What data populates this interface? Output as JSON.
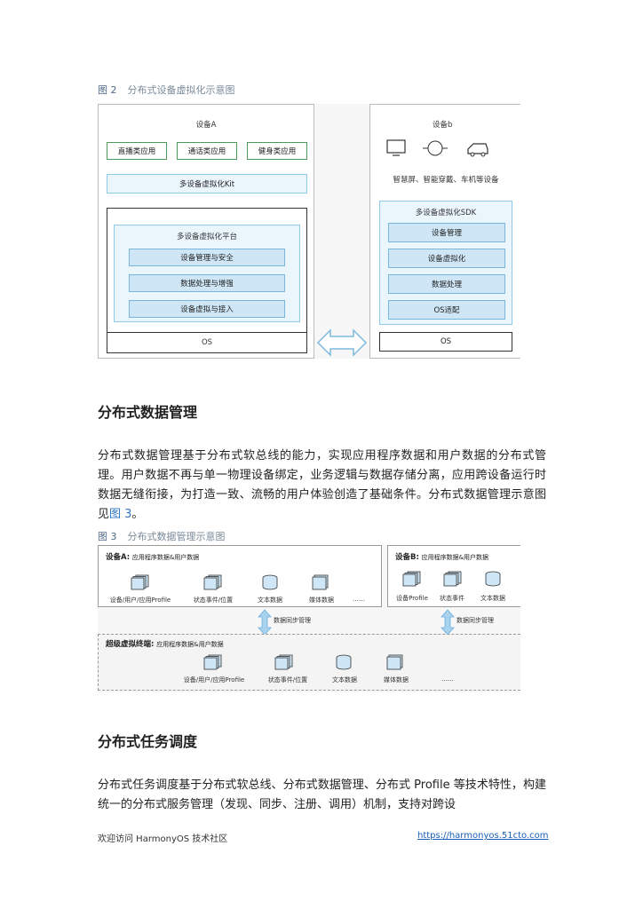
{
  "fig2": {
    "num": "图 2",
    "caption": "分布式设备虚拟化示意图",
    "device_a": {
      "title": "设备A",
      "apps": [
        "直播类应用",
        "通话类应用",
        "健身类应用"
      ],
      "kit": "多设备虚拟化Kit",
      "platform": "多设备虚拟化平台",
      "platform_items": [
        "设备管理与安全",
        "数据处理与增强",
        "设备虚拟与接入"
      ],
      "os": "OS"
    },
    "device_b": {
      "title": "设备b",
      "devices_label": "智慧屏、智能穿戴、车机等设备",
      "sdk": "多设备虚拟化SDK",
      "sdk_items": [
        "设备管理",
        "设备虚拟化",
        "数据处理",
        "OS适配"
      ],
      "os": "OS"
    }
  },
  "section1": {
    "heading": "分布式数据管理",
    "para": "分布式数据管理基于分布式软总线的能力，实现应用程序数据和用户数据的分布式管理。用户数据不再与单一物理设备绑定，业务逻辑与数据存储分离，应用跨设备运行时数据无缝衔接，为打造一致、流畅的用户体验创造了基础条件。分布式数据管理示意图见",
    "link": "图 3",
    "para_end": "。"
  },
  "fig3": {
    "num": "图 3",
    "caption": "分布式数据管理示意图",
    "device_a": {
      "title": "设备A:",
      "subtitle": "应用程序数据&用户数据",
      "items": [
        "设备/用户/应用Profile",
        "状态事件/位置",
        "文本数据",
        "媒体数据",
        "……"
      ]
    },
    "device_b": {
      "title": "设备B:",
      "subtitle": "应用程序数据&用户数据",
      "items": [
        "设备Profile",
        "状态事件",
        "文本数据"
      ]
    },
    "sync_label_a": "数据同步管理",
    "sync_label_b": "数据同步管理",
    "super": {
      "title": "超级虚拟终端:",
      "subtitle": "应用程序数据&用户数据",
      "items": [
        "设备/用户/应用Profile",
        "状态事件/位置",
        "文本数据",
        "媒体数据",
        "……"
      ]
    }
  },
  "section2": {
    "heading": "分布式任务调度",
    "para": "分布式任务调度基于分布式软总线、分布式数据管理、分布式 Profile 等技术特性，构建统一的分布式服务管理（发现、同步、注册、调用）机制，支持对跨设"
  },
  "footer": {
    "left": "欢迎访问 HarmonyOS 技术社区",
    "right": "https://harmonyos.51cto.com"
  }
}
